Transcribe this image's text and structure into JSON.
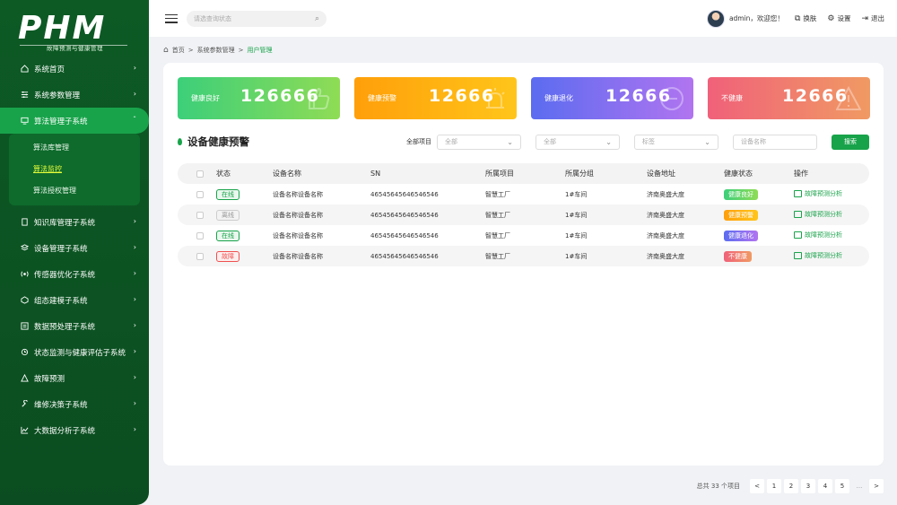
{
  "app": {
    "logo": "PHM",
    "logo_sub": "故障预测与健康管理"
  },
  "sidebar": {
    "items": [
      {
        "label": "系统首页",
        "icon": "home-icon"
      },
      {
        "label": "系统参数管理",
        "icon": "sliders-icon"
      },
      {
        "label": "算法管理子系统",
        "icon": "monitor-icon",
        "active": true,
        "children": [
          {
            "label": "算法库管理"
          },
          {
            "label": "算法监控",
            "selected": true
          },
          {
            "label": "算法授权管理"
          }
        ]
      },
      {
        "label": "知识库管理子系统",
        "icon": "book-icon"
      },
      {
        "label": "设备管理子系统",
        "icon": "layers-icon"
      },
      {
        "label": "传感器优化子系统",
        "icon": "sensor-icon"
      },
      {
        "label": "组态建模子系统",
        "icon": "model-icon"
      },
      {
        "label": "数据预处理子系统",
        "icon": "data-icon"
      },
      {
        "label": "状态监测与健康评估子系统",
        "icon": "monitor-status-icon"
      },
      {
        "label": "故障预测",
        "icon": "warning-icon"
      },
      {
        "label": "维修决策子系统",
        "icon": "wrench-icon"
      },
      {
        "label": "大数据分析子系统",
        "icon": "chart-icon"
      }
    ]
  },
  "header": {
    "search_placeholder": "请选查询状态",
    "user_greeting": "admin，欢迎您！",
    "switch_label": "换肤",
    "settings_label": "设置",
    "logout_label": "退出"
  },
  "breadcrumb": {
    "home": "首页",
    "sep1": ">",
    "mid": "系统参数管理",
    "sep2": ">",
    "current": "用户管理"
  },
  "cards": [
    {
      "label": "健康良好",
      "value": "126666",
      "icon": "thumbs-up-icon"
    },
    {
      "label": "健康预警",
      "value": "12666",
      "icon": "siren-icon"
    },
    {
      "label": "健康退化",
      "value": "12666",
      "icon": "minus-circle-icon"
    },
    {
      "label": "不健康",
      "value": "12666",
      "icon": "warning-triangle-icon"
    }
  ],
  "section": {
    "title": "设备健康预警",
    "filter_label": "全部项目",
    "select1": "全部",
    "select2": "全部",
    "select3": "标签",
    "name_placeholder": "设备名称",
    "search_button": "搜索"
  },
  "table": {
    "headers": [
      "状态",
      "设备名称",
      "SN",
      "所属项目",
      "所属分组",
      "设备地址",
      "健康状态",
      "操作"
    ],
    "rows": [
      {
        "status": "在线",
        "status_type": "online",
        "name": "设备名称设备名称",
        "sn": "46545645646546546",
        "project": "智慧工厂",
        "group": "1#车间",
        "address": "济南奥盛大度",
        "health": "健康良好",
        "health_type": "good",
        "op": "故障预测分析"
      },
      {
        "status": "离线",
        "status_type": "offline",
        "name": "设备名称设备名称",
        "sn": "46545645646546546",
        "project": "智慧工厂",
        "group": "1#车间",
        "address": "济南奥盛大度",
        "health": "健康预警",
        "health_type": "warn",
        "op": "故障预测分析"
      },
      {
        "status": "在线",
        "status_type": "online",
        "name": "设备名称设备名称",
        "sn": "46545645646546546",
        "project": "智慧工厂",
        "group": "1#车间",
        "address": "济南奥盛大度",
        "health": "健康退化",
        "health_type": "deg",
        "op": "故障预测分析"
      },
      {
        "status": "故障",
        "status_type": "fault",
        "name": "设备名称设备名称",
        "sn": "46545645646546546",
        "project": "智慧工厂",
        "group": "1#车间",
        "address": "济南奥盛大度",
        "health": "不健康",
        "health_type": "bad",
        "op": "故障预测分析"
      }
    ]
  },
  "pagination": {
    "total": "总共 33 个项目",
    "prev": "<",
    "pages": [
      "1",
      "2",
      "3",
      "4",
      "5"
    ],
    "ellipsis": "...",
    "next": ">"
  }
}
